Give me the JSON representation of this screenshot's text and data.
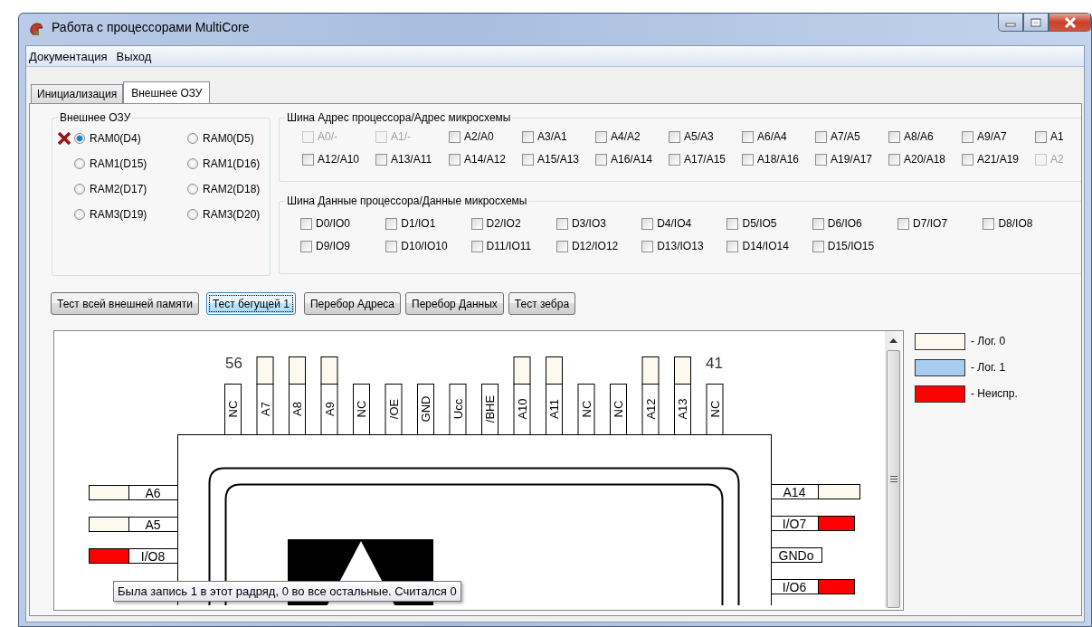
{
  "window": {
    "title": "Работа с процессорами MultiCore"
  },
  "menu": [
    "Документация",
    "Выход"
  ],
  "tabs": [
    {
      "label": "Инициализация",
      "selected": false
    },
    {
      "label": "Внешнее ОЗУ",
      "selected": true
    }
  ],
  "ram_group": {
    "title": "Внешнее ОЗУ",
    "options": [
      {
        "label": "RAM0(D4)",
        "selected": true,
        "flagged": true
      },
      {
        "label": "RAM0(D5)",
        "selected": false,
        "flagged": false
      },
      {
        "label": "RAM1(D15)",
        "selected": false,
        "flagged": false
      },
      {
        "label": "RAM1(D16)",
        "selected": false,
        "flagged": false
      },
      {
        "label": "RAM2(D17)",
        "selected": false,
        "flagged": false
      },
      {
        "label": "RAM2(D18)",
        "selected": false,
        "flagged": false
      },
      {
        "label": "RAM3(D19)",
        "selected": false,
        "flagged": false
      },
      {
        "label": "RAM3(D20)",
        "selected": false,
        "flagged": false
      }
    ]
  },
  "address_bus": {
    "title": "Шина Адрес процессора/Адрес микросхемы",
    "lines": [
      {
        "label": "A0/-",
        "checked": false,
        "disabled": true
      },
      {
        "label": "A1/-",
        "checked": false,
        "disabled": true
      },
      {
        "label": "A2/A0",
        "checked": false,
        "disabled": false
      },
      {
        "label": "A3/A1",
        "checked": false,
        "disabled": false
      },
      {
        "label": "A4/A2",
        "checked": false,
        "disabled": false
      },
      {
        "label": "A5/A3",
        "checked": false,
        "disabled": false
      },
      {
        "label": "A6/A4",
        "checked": false,
        "disabled": false
      },
      {
        "label": "A7/A5",
        "checked": false,
        "disabled": false
      },
      {
        "label": "A8/A6",
        "checked": false,
        "disabled": false
      },
      {
        "label": "A9/A7",
        "checked": false,
        "disabled": false
      },
      {
        "label": "A1",
        "checked": false,
        "disabled": false
      },
      {
        "label": "A12/A10",
        "checked": false,
        "disabled": false
      },
      {
        "label": "A13/A11",
        "checked": false,
        "disabled": false
      },
      {
        "label": "A14/A12",
        "checked": false,
        "disabled": false
      },
      {
        "label": "A15/A13",
        "checked": false,
        "disabled": false
      },
      {
        "label": "A16/A14",
        "checked": false,
        "disabled": false
      },
      {
        "label": "A17/A15",
        "checked": false,
        "disabled": false
      },
      {
        "label": "A18/A16",
        "checked": false,
        "disabled": false
      },
      {
        "label": "A19/A17",
        "checked": false,
        "disabled": false
      },
      {
        "label": "A20/A18",
        "checked": false,
        "disabled": false
      },
      {
        "label": "A21/A19",
        "checked": false,
        "disabled": false
      },
      {
        "label": "A2",
        "checked": false,
        "disabled": true
      }
    ]
  },
  "data_bus": {
    "title": "Шина Данные процессора/Данные микросхемы",
    "lines": [
      {
        "label": "D0/IO0",
        "checked": false
      },
      {
        "label": "D1/IO1",
        "checked": false
      },
      {
        "label": "D2/IO2",
        "checked": false
      },
      {
        "label": "D3/IO3",
        "checked": false
      },
      {
        "label": "D4/IO4",
        "checked": false
      },
      {
        "label": "D5/IO5",
        "checked": false
      },
      {
        "label": "D6/IO6",
        "checked": false
      },
      {
        "label": "D7/IO7",
        "checked": false
      },
      {
        "label": "D8/IO8",
        "checked": false
      },
      {
        "label": "D9/IO9",
        "checked": false
      },
      {
        "label": "D10/IO10",
        "checked": false
      },
      {
        "label": "D11/IO11",
        "checked": false
      },
      {
        "label": "D12/IO12",
        "checked": false
      },
      {
        "label": "D13/IO13",
        "checked": false
      },
      {
        "label": "D14/IO14",
        "checked": false
      },
      {
        "label": "D15/IO15",
        "checked": false
      }
    ]
  },
  "buttons": [
    {
      "label": "Тест всей внешней памяти",
      "focused": false
    },
    {
      "label": "Тест бегущей 1",
      "focused": true
    },
    {
      "label": "Перебор Адреса",
      "focused": false
    },
    {
      "label": "Перебор Данных",
      "focused": false
    },
    {
      "label": "Тест зебра",
      "focused": false
    }
  ],
  "diagram": {
    "pin_numbers": [
      "56",
      "41"
    ],
    "top_pins": [
      {
        "label": "NC"
      },
      {
        "label": "A7",
        "color": "#fdf9ee"
      },
      {
        "label": "A8",
        "color": "#fdf9ee"
      },
      {
        "label": "A9",
        "color": "#fdf9ee"
      },
      {
        "label": "NC"
      },
      {
        "label": "/OE"
      },
      {
        "label": "GND"
      },
      {
        "label": "Ucc"
      },
      {
        "label": "/BHE"
      },
      {
        "label": "A10",
        "color": "#fdf9ee"
      },
      {
        "label": "A11",
        "color": "#fdf9ee"
      },
      {
        "label": "NC"
      },
      {
        "label": "NC"
      },
      {
        "label": "A12",
        "color": "#fdf9ee"
      },
      {
        "label": "A13",
        "color": "#fdf9ee"
      },
      {
        "label": "NC"
      }
    ],
    "left_pins": [
      {
        "label": "A6",
        "color": "#fdf9ee"
      },
      {
        "label": "A5",
        "color": "#fdf9ee"
      },
      {
        "label": "I/O8",
        "color": "#ff0000"
      }
    ],
    "right_pins": [
      {
        "label": "A14",
        "color": "#fdf9ee"
      },
      {
        "label": "I/O7",
        "color": "#ff0000"
      },
      {
        "label": "GNDo"
      },
      {
        "label": "I/O6",
        "color": "#ff0000"
      }
    ]
  },
  "legend": [
    {
      "label": "- Лог. 0",
      "color": "#fdf9ee"
    },
    {
      "label": "- Лог. 1",
      "color": "#a8ccf0"
    },
    {
      "label": "- Неиспр.",
      "color": "#ff0000"
    }
  ],
  "tooltip": "Была запись 1 в этот радряд, 0 во все остальные. Считался 0"
}
